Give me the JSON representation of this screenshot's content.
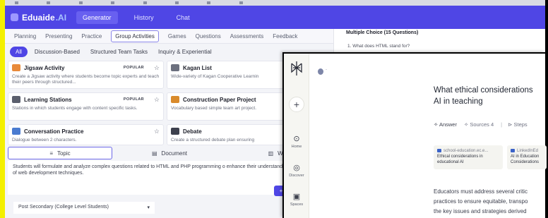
{
  "browser": {
    "bookmarks": [
      "",
      "",
      "",
      "",
      "",
      "",
      "",
      "",
      ""
    ]
  },
  "appbar": {
    "brand": "Eduaide",
    "brand_suffix": ".AI",
    "tabs": [
      {
        "label": "Generator",
        "active": true
      },
      {
        "label": "History",
        "active": false
      },
      {
        "label": "Chat",
        "active": false
      }
    ]
  },
  "subtabs": [
    {
      "label": "Planning"
    },
    {
      "label": "Presenting"
    },
    {
      "label": "Practice"
    },
    {
      "label": "Group Activities",
      "active": true
    },
    {
      "label": "Games"
    },
    {
      "label": "Questions"
    },
    {
      "label": "Assessments"
    },
    {
      "label": "Feedback"
    }
  ],
  "filters": [
    {
      "label": "All",
      "active": true
    },
    {
      "label": "Discussion-Based"
    },
    {
      "label": "Structured Team Tasks"
    },
    {
      "label": "Inquiry & Experiential"
    }
  ],
  "cards": [
    {
      "title": "Jigsaw Activity",
      "badge": "POPULAR",
      "star": "☆",
      "desc": "Create a Jigsaw activity where students become topic experts and teach their peers through structured...",
      "icon_color": "#e88a3a"
    },
    {
      "title": "Kagan List",
      "badge": "P",
      "star": "",
      "desc": "Wide-variety of Kagan Cooperative Learnin",
      "icon_color": "#6b6f7e"
    },
    {
      "title": "Learning Stations",
      "badge": "POPULAR",
      "star": "☆",
      "desc": "Stations in which students engage with content specific tasks.",
      "icon_color": "#5a5e6c"
    },
    {
      "title": "Construction Paper Project",
      "badge": "",
      "star": "",
      "desc": "Vocabulary based simple team art project.",
      "icon_color": "#d98a2b"
    },
    {
      "title": "Conversation Practice",
      "badge": "",
      "star": "☆",
      "desc": "Dialogue between 2 characters.",
      "icon_color": "#4a7bd0"
    },
    {
      "title": "Debate",
      "badge": "",
      "star": "",
      "desc": "Create a structured debate plan ensuring",
      "icon_color": "#3d404d"
    }
  ],
  "input_tabs": [
    {
      "label": "Topic",
      "icon": "≡",
      "active": true
    },
    {
      "label": "Document",
      "icon": "▤"
    },
    {
      "label": "Webs",
      "icon": "▥"
    }
  ],
  "prompt_text": "Students will formulate and analyze complex questions related to HTML and PHP programming o enhance their understanding and application of web development techniques.",
  "generate_icon": "+",
  "level_select": {
    "value": "Post Secondary (College Level Students)",
    "chevron": "▾"
  },
  "right_panel": {
    "title": "Multiple Choice (15 Questions)",
    "q1": "1.   What does HTML stand for?"
  },
  "overlay": {
    "dash": "-",
    "plus": "+",
    "sidebar": [
      {
        "label": "Home",
        "glyph": "⊙"
      },
      {
        "label": "Discover",
        "glyph": "◎"
      },
      {
        "label": "Spaces",
        "glyph": "▣"
      }
    ],
    "title_line1": "What ethical considerations",
    "title_line2": "AI in teaching",
    "tabs": [
      {
        "label": "Answer",
        "icon": "✧"
      },
      {
        "label": "Sources",
        "icon": "✧",
        "count": "4"
      },
      {
        "label": "Steps",
        "icon": "⊳"
      }
    ],
    "sources": [
      {
        "site": "school-education.ec.e...",
        "text": [
          "Ethical considerations in",
          "educational AI"
        ]
      },
      {
        "site": "LinkedInEd",
        "text": [
          "AI in Education",
          "Considerations"
        ]
      }
    ],
    "body": [
      "Educators must address several critic",
      "practices to ensure equitable, transpo",
      "the key issues and strategies derived"
    ]
  }
}
